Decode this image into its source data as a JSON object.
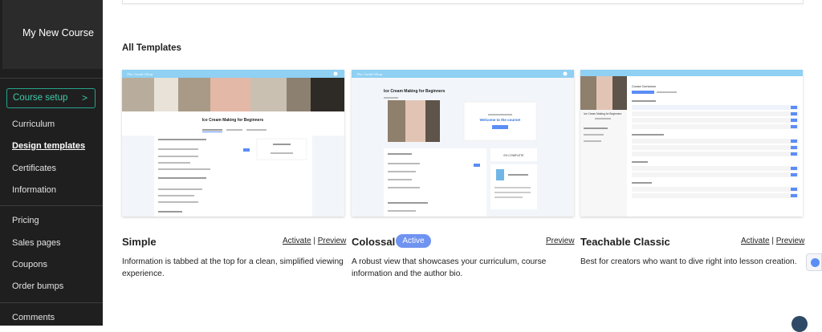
{
  "sidebar": {
    "course_title": "My New Course",
    "course_setup": "Course setup",
    "chevron": ">",
    "items": [
      {
        "label": "Curriculum"
      },
      {
        "label": "Design templates"
      },
      {
        "label": "Certificates"
      },
      {
        "label": "Information"
      },
      {
        "label": "Pricing"
      },
      {
        "label": "Sales pages"
      },
      {
        "label": "Coupons"
      },
      {
        "label": "Order bumps"
      },
      {
        "label": "Comments"
      }
    ]
  },
  "main": {
    "section_title": "All Templates",
    "templates": [
      {
        "name": "Simple",
        "activate": "Activate",
        "separator": "|",
        "preview": "Preview",
        "description": "Information is tabbed at the top for a clean, simplified viewing experience.",
        "thumb": {
          "course": "Ice Cream Making for Beginners",
          "logo": "The Candi Shop"
        }
      },
      {
        "name": "Colossal",
        "badge": "Active",
        "preview": "Preview",
        "description": "A robust view that showcases your curriculum, course information and the author bio.",
        "thumb": {
          "course": "Ice Cream Making for Beginners",
          "welcome": "Welcome to the course!",
          "complete": "0% COMPLETE",
          "logo": "The Candi Shop"
        }
      },
      {
        "name": "Teachable Classic",
        "activate": "Activate",
        "separator": "|",
        "preview": "Preview",
        "description": "Best for creators who want to dive right into lesson creation.",
        "thumb": {
          "course": "Ice Cream Making for Beginners",
          "curriculum": "Course Curriculum"
        }
      }
    ]
  },
  "colors": {
    "accent": "#40c9a9",
    "badge": "#6f93f0",
    "thumb_header": "#8fd0f3",
    "sidebar_bg": "#1f1f1f"
  }
}
